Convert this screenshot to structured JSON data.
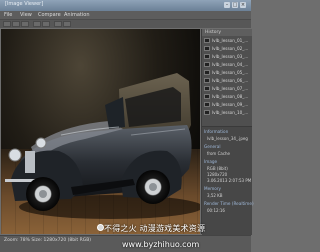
{
  "window": {
    "title": "[Image Viewer]"
  },
  "menu": [
    "File",
    "View",
    "Compare",
    "Animation"
  ],
  "files": [
    "lvlb_lesson_01_...",
    "lvlb_lesson_02_...",
    "lvlb_lesson_03_...",
    "lvlb_lesson_04_...",
    "lvlb_lesson_05_...",
    "lvlb_lesson_06_...",
    "lvlb_lesson_07_...",
    "lvlb_lesson_08_...",
    "lvlb_lesson_09_...",
    "lvlb_lesson_10_..."
  ],
  "panel": {
    "header": "History"
  },
  "info": {
    "section_info": "Information",
    "filename": "lvlb_lesson_34_.jpeg",
    "section_general": "General",
    "status": "from Cache",
    "section_image": "Image",
    "format": "RGB (8bit)",
    "size": "1280x720",
    "date": "3.06.2013 2:07:53 PM",
    "section_memory": "Memory",
    "memory": "3,52 KB",
    "section_render": "Render Time (Realtime)",
    "render_time": "00:12:16"
  },
  "status": {
    "text": "Zoom: 78%   Size: 1280x720 (8bit RGB)"
  },
  "watermark": {
    "line1": "不得之火 动漫游戏美术资源",
    "line2": "www.byzhihuo.com"
  }
}
